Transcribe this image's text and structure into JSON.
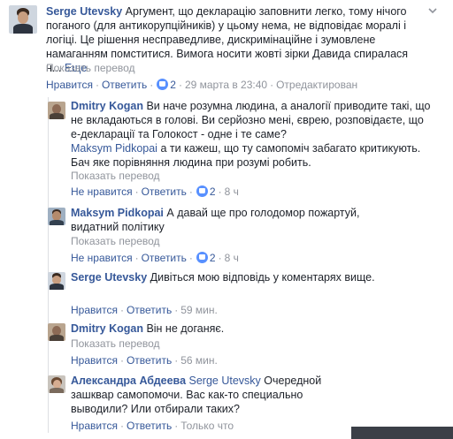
{
  "comments": [
    {
      "author": "Serge Utevsky",
      "text": "Аргумент, що декларацію заповнити легко, тому нічого поганого (для антикорупційників) у цьому нема, не відповідає моралі і логіці. Це рішення несправедливе, дискримінаційне і зумовлене намаганням помститися. Вимога носити жовті зірки Давида спиралася н...",
      "more": "Еще",
      "translate": "Показать перевод",
      "like": "Нравится",
      "reply": "Ответить",
      "reactions": "2",
      "time": "29 марта в 23:40",
      "edited": "Отредактирован"
    },
    {
      "author": "Dmitry Kogan",
      "text": "Ви наче розумна людина, а аналогії приводите такі, що не вкладаються в голові. Ви серйозно мені, єврею, розповідаєте, що е-декларації та Голокост - одне і те саме?",
      "mention": "Maksym Pidkopai",
      "text2": "а ти кажеш, що ту самопоміч забагато критикують. Бач яке порівняння людина при розумі робить.",
      "translate": "Показать перевод",
      "like": "Не нравится",
      "reply": "Ответить",
      "reactions": "2",
      "time": "8 ч"
    },
    {
      "author": "Maksym Pidkopai",
      "text": "А давай ще про голодомор пожартуй, видатний політику",
      "translate": "Показать перевод",
      "like": "Не нравится",
      "reply": "Ответить",
      "reactions": "2",
      "time": "8 ч"
    },
    {
      "author": "Serge Utevsky",
      "text": "Дивіться мою відповідь у коментарях вище.",
      "like": "Нравится",
      "reply": "Ответить",
      "time": "59 мин."
    },
    {
      "author": "Dmitry Kogan",
      "text": "Він не доганяє.",
      "translate": "Показать перевод",
      "like": "Нравится",
      "reply": "Ответить",
      "time": "56 мин."
    },
    {
      "author": "Александра Абдеева",
      "mention": "Serge Utevsky",
      "text": "Очередной зашквар самопомочи. Вас как-то специально выводили? Или отбирали таких?",
      "like": "Нравится",
      "reply": "Ответить",
      "time": "Только что"
    }
  ],
  "colors": {
    "link": "#365899",
    "meta": "#90949c",
    "text": "#1d2129",
    "reaction": "#5890ff"
  },
  "icons": {
    "menu": "chevron-down-icon",
    "reaction": "like-reaction-icon"
  }
}
